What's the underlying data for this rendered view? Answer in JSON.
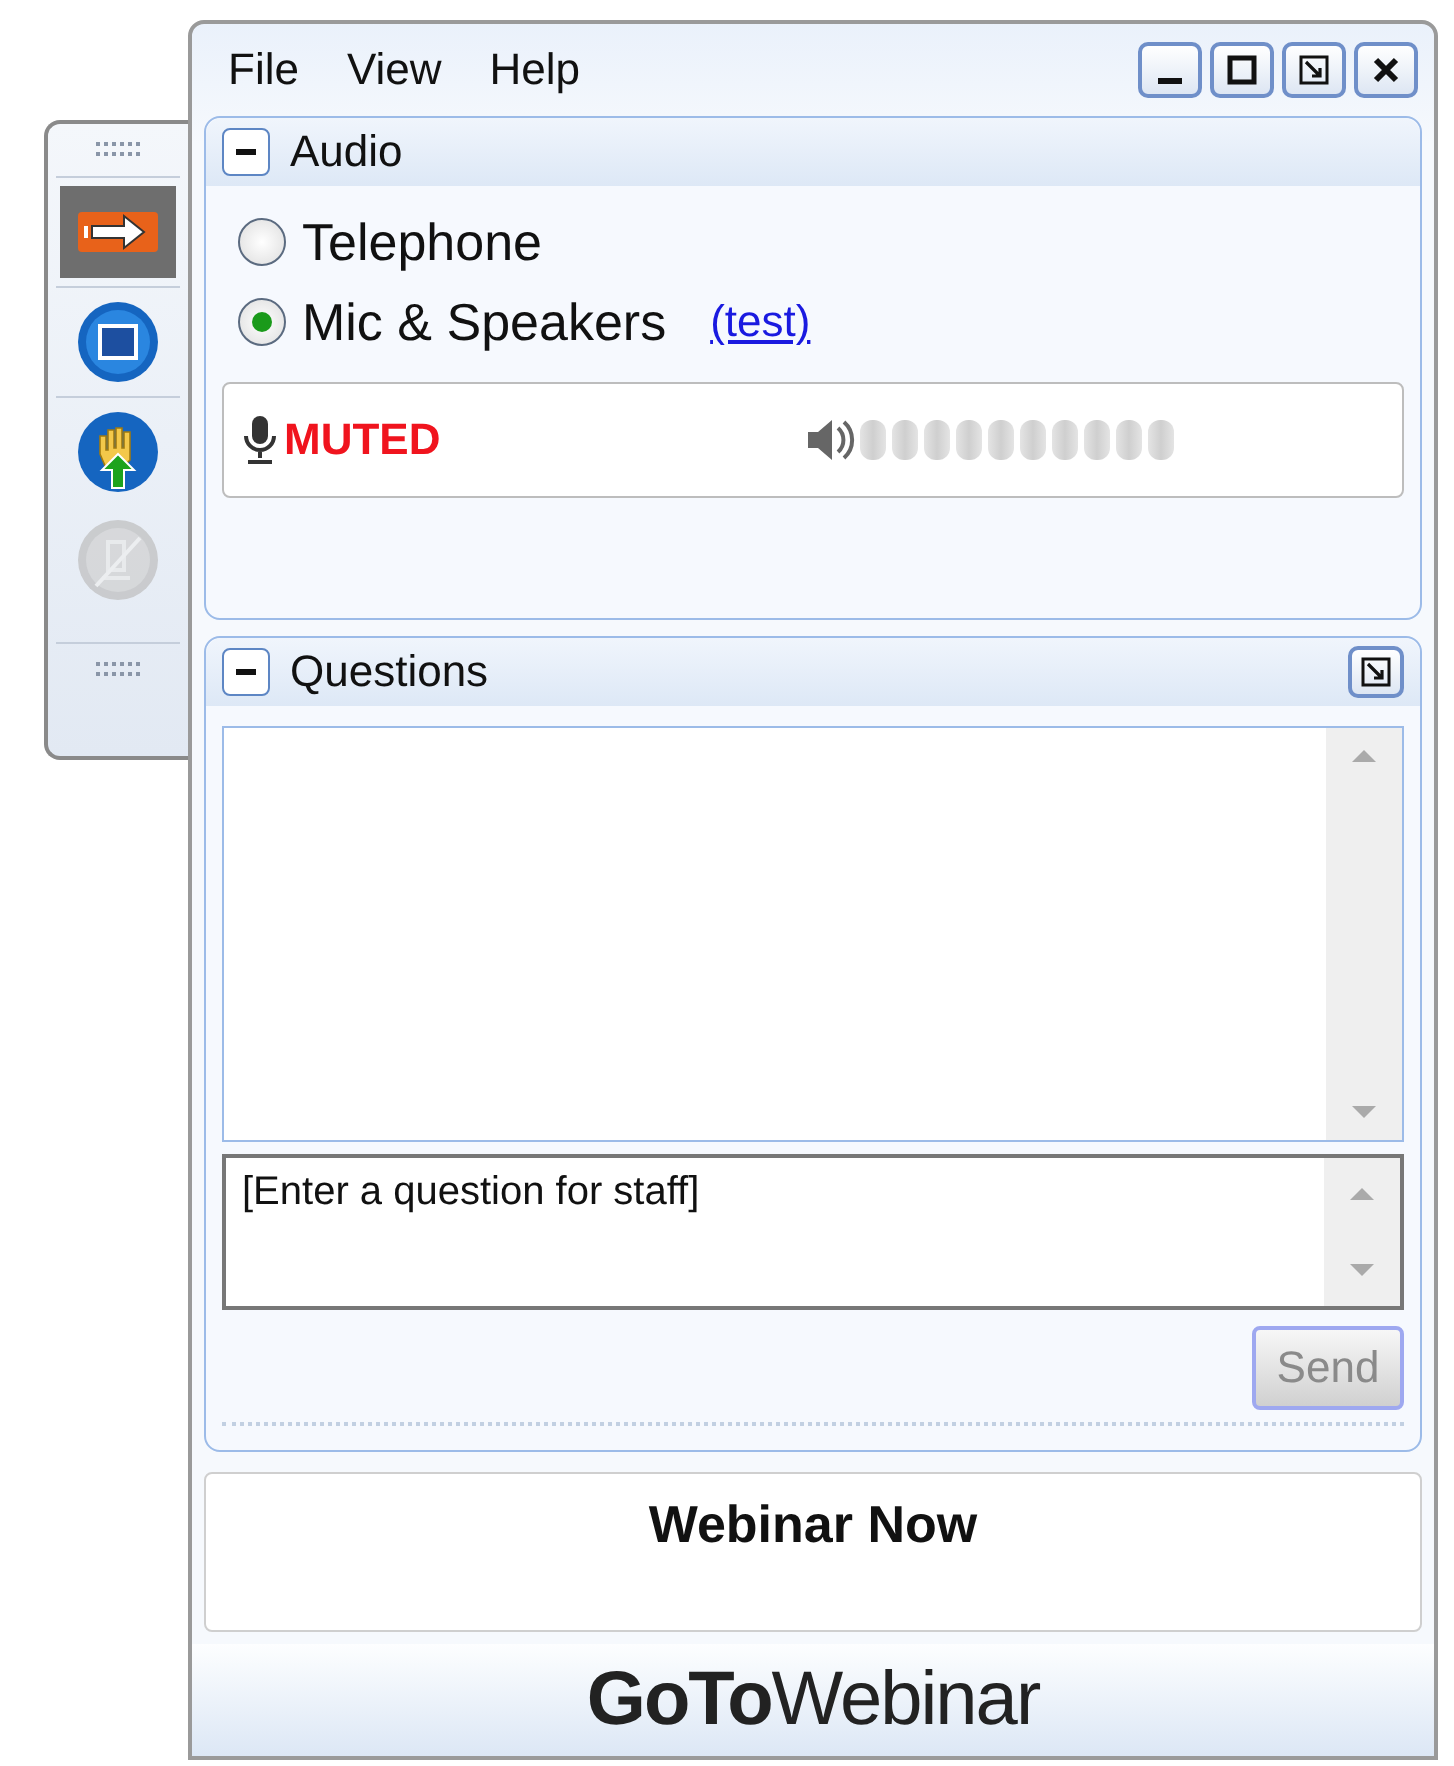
{
  "toolbar": {
    "buttons": [
      {
        "kind": "arrow",
        "selected": true,
        "disabled": false
      },
      {
        "kind": "screen",
        "selected": false,
        "disabled": false
      },
      {
        "kind": "hand",
        "selected": false,
        "disabled": false
      },
      {
        "kind": "mic",
        "selected": false,
        "disabled": true
      }
    ]
  },
  "window": {
    "menu": [
      "File",
      "View",
      "Help"
    ]
  },
  "audio": {
    "title": "Audio",
    "expanded": true,
    "options": [
      {
        "label": "Telephone",
        "selected": false
      },
      {
        "label": "Mic & Speakers",
        "selected": true,
        "link": "(test)"
      }
    ],
    "mic_status": "MUTED"
  },
  "questions": {
    "title": "Questions",
    "expanded": true,
    "placeholder": "[Enter a question for staff]",
    "send": {
      "label": "Send",
      "disabled": true
    }
  },
  "webinar": {
    "title": "Webinar Now"
  },
  "logo": "**GoTo**Webinar"
}
